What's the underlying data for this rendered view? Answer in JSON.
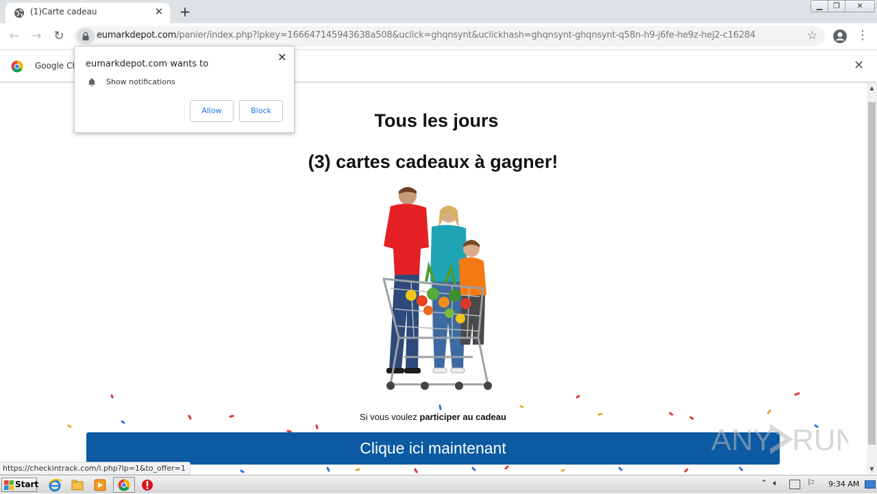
{
  "browser": {
    "tab_title": "(1)Carte cadeau",
    "url_host": "eumarkdepot.com",
    "url_path": "/panier/index.php?lpkey=166647145943638a508&uclick=ghqnsynt&uclickhash=ghqnsynt-ghqnsynt-q58n-h9-j6fe-he9z-hej2-c16284",
    "infobar_text": "Google Ch",
    "status_url": "https://checkintrack.com/l.php?lp=1&to_offer=1"
  },
  "notification_prompt": {
    "title": "eumarkdepot.com wants to",
    "permission": "Show notifications",
    "allow_label": "Allow",
    "block_label": "Block"
  },
  "page": {
    "headline": "Tous les jours",
    "subhead": "(3) cartes cadeaux à gagner!",
    "participate_prefix": "Si vous voulez ",
    "participate_bold": "participer au cadeau",
    "cta_label": "Clique ici maintenant"
  },
  "watermark": {
    "text_left": "ANY",
    "text_right": "RUN"
  },
  "taskbar": {
    "start_label": "Start",
    "clock": "9:34 AM"
  },
  "icons": {
    "tab_favicon": "globe-icon",
    "lock": "lock-icon",
    "bell": "bell-icon",
    "star": "star-icon",
    "profile": "account-icon"
  },
  "colors": {
    "cta": "#0b5aa2",
    "dialog_button_text": "#1a73e8"
  }
}
